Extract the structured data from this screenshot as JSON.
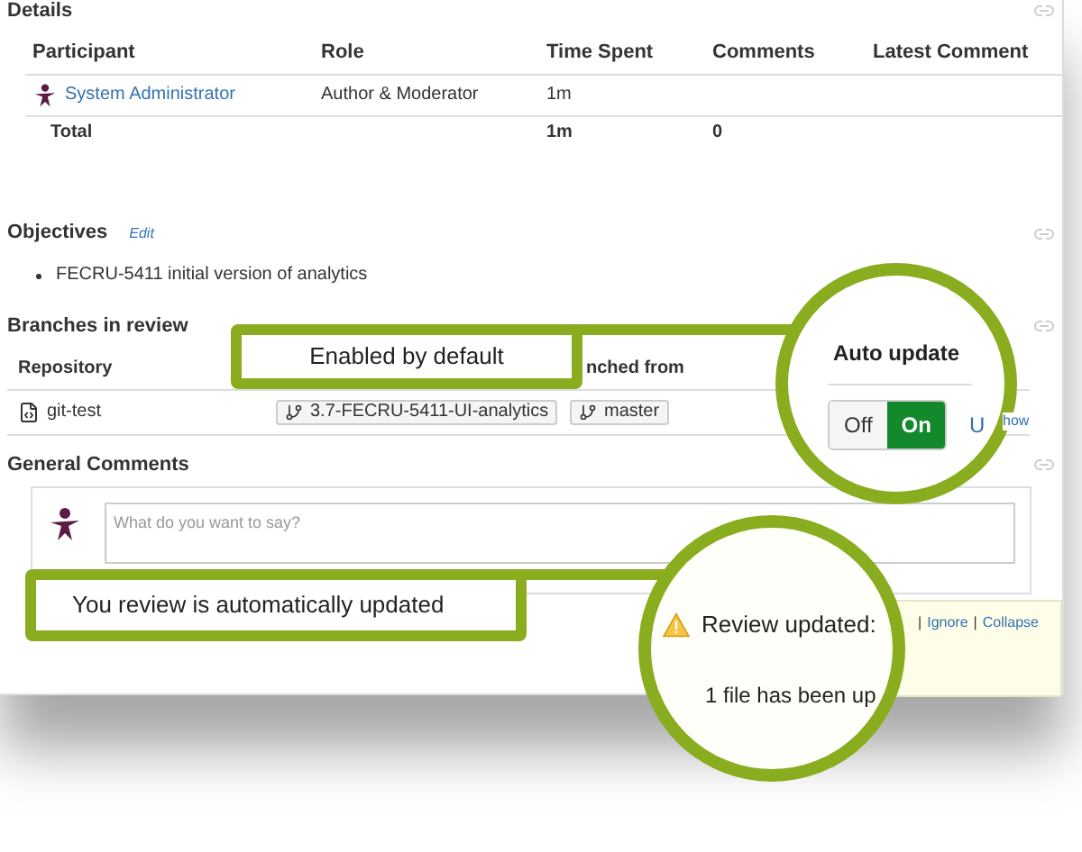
{
  "details": {
    "title": "Details",
    "columns": [
      "Participant",
      "Role",
      "Time Spent",
      "Comments",
      "Latest Comment"
    ],
    "rows": [
      {
        "participant": "System Administrator",
        "role": "Author & Moderator",
        "time_spent": "1m"
      }
    ],
    "total": {
      "label": "Total",
      "time_spent": "1m",
      "comments": "0"
    }
  },
  "objectives": {
    "title": "Objectives",
    "edit": "Edit",
    "items": [
      "FECRU-5411 initial version of analytics"
    ]
  },
  "branches": {
    "title": "Branches in review",
    "columns": [
      "Repository",
      "nched from"
    ],
    "rows": [
      {
        "repository": "git-test",
        "branch": "3.7-FECRU-5411-UI-analytics",
        "from": "master"
      }
    ]
  },
  "general_comments": {
    "title": "General Comments",
    "placeholder": "What do you want to say?"
  },
  "auto_update": {
    "title": "Auto update",
    "options": [
      {
        "label": "Off",
        "selected": false
      },
      {
        "label": "On",
        "selected": true
      }
    ],
    "link_parts": [
      "U",
      "how"
    ]
  },
  "notification": {
    "title": "Review updated:",
    "links": [
      {
        "separator": "|",
        "label": "Ignore"
      },
      {
        "separator": "|",
        "label": "Collapse"
      }
    ],
    "message": "1 file has been up"
  },
  "callouts": [
    "Enabled by default",
    "You review is automatically updated"
  ]
}
